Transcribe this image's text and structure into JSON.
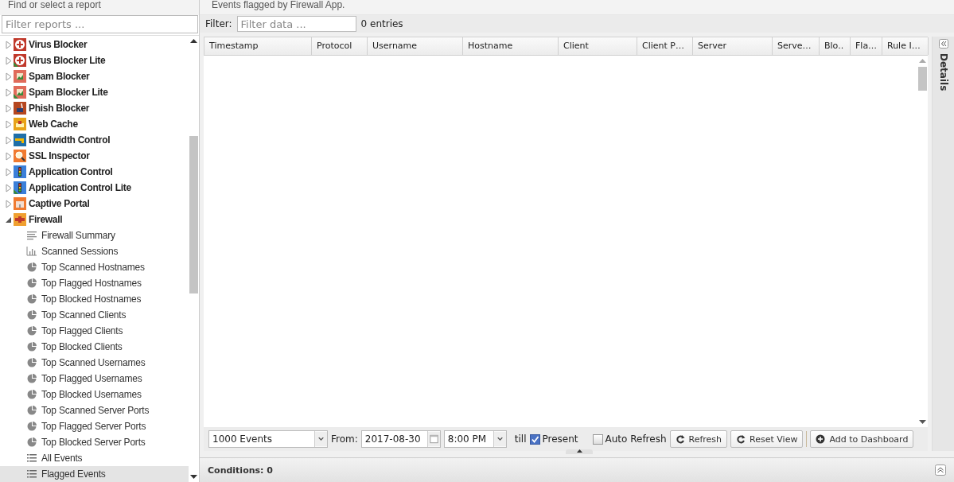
{
  "left_panel": {
    "title": "Find or select a report",
    "filter": {
      "placeholder": "Filter reports ..."
    },
    "tree": [
      {
        "label": "Virus Blocker",
        "kind": "cross",
        "color": "#c0392b",
        "lite": false,
        "expanded": false,
        "selected": false
      },
      {
        "label": "Virus Blocker Lite",
        "kind": "cross",
        "color": "#c0392b",
        "lite": true,
        "expanded": false,
        "selected": false
      },
      {
        "label": "Spam Blocker",
        "kind": "image",
        "color": "#e06b5a",
        "lite": false,
        "expanded": false,
        "selected": false
      },
      {
        "label": "Spam Blocker Lite",
        "kind": "image",
        "color": "#e06b5a",
        "lite": true,
        "expanded": false,
        "selected": false
      },
      {
        "label": "Phish Blocker",
        "kind": "hook",
        "color": "#b5461f",
        "lite": false,
        "expanded": false,
        "selected": false
      },
      {
        "label": "Web Cache",
        "kind": "tray",
        "color": "#e8a317",
        "lite": false,
        "expanded": false,
        "selected": false
      },
      {
        "label": "Bandwidth Control",
        "kind": "tap",
        "color": "#1f6fa8",
        "lite": false,
        "expanded": false,
        "selected": false
      },
      {
        "label": "SSL Inspector",
        "kind": "lens",
        "color": "#f07a30",
        "lite": false,
        "expanded": false,
        "selected": false
      },
      {
        "label": "Application Control",
        "kind": "light",
        "color": "#3b7fd9",
        "lite": false,
        "expanded": false,
        "selected": false
      },
      {
        "label": "Application Control Lite",
        "kind": "light",
        "color": "#3b7fd9",
        "lite": true,
        "expanded": false,
        "selected": false
      },
      {
        "label": "Captive Portal",
        "kind": "castle",
        "color": "#f07a30",
        "lite": false,
        "expanded": false,
        "selected": false
      },
      {
        "label": "Firewall",
        "kind": "wall",
        "color": "#f0a030",
        "lite": false,
        "expanded": true,
        "selected": false,
        "children": [
          {
            "label": "Firewall Summary",
            "kind": "text",
            "selected": false
          },
          {
            "label": "Scanned Sessions",
            "kind": "bars",
            "selected": false
          },
          {
            "label": "Top Scanned Hostnames",
            "kind": "pie",
            "selected": false
          },
          {
            "label": "Top Flagged Hostnames",
            "kind": "pie",
            "selected": false
          },
          {
            "label": "Top Blocked Hostnames",
            "kind": "pie",
            "selected": false
          },
          {
            "label": "Top Scanned Clients",
            "kind": "pie",
            "selected": false
          },
          {
            "label": "Top Flagged Clients",
            "kind": "pie",
            "selected": false
          },
          {
            "label": "Top Blocked Clients",
            "kind": "pie",
            "selected": false
          },
          {
            "label": "Top Scanned Usernames",
            "kind": "pie",
            "selected": false
          },
          {
            "label": "Top Flagged Usernames",
            "kind": "pie",
            "selected": false
          },
          {
            "label": "Top Blocked Usernames",
            "kind": "pie",
            "selected": false
          },
          {
            "label": "Top Scanned Server Ports",
            "kind": "pie",
            "selected": false
          },
          {
            "label": "Top Flagged Server Ports",
            "kind": "pie",
            "selected": false
          },
          {
            "label": "Top Blocked Server Ports",
            "kind": "pie",
            "selected": false
          },
          {
            "label": "All Events",
            "kind": "list",
            "selected": false
          },
          {
            "label": "Flagged Events",
            "kind": "list",
            "selected": true
          }
        ]
      }
    ]
  },
  "report": {
    "description": "Events flagged by Firewall App.",
    "filter_label": "Filter:",
    "filter": {
      "placeholder": "Filter data ..."
    },
    "count": "0 entries",
    "columns": [
      "Timestamp",
      "Protocol",
      "Username",
      "Hostname",
      "Client",
      "Client P…",
      "Server",
      "Serve…",
      "Blo..",
      "Fla…",
      "Rule I…"
    ],
    "limit": "1000 Events",
    "from_label": "From:",
    "date": "2017-08-30",
    "time": "8:00 PM",
    "till_label": "till",
    "present": {
      "label": "Present",
      "checked": true
    },
    "auto_refresh": {
      "label": "Auto Refresh",
      "checked": false
    },
    "buttons": [
      {
        "label": "Refresh",
        "kind": "refresh"
      },
      {
        "label": "Reset View",
        "kind": "refresh"
      },
      {
        "label": "Add to Dashboard",
        "kind": "add"
      }
    ],
    "conditions": "Conditions: 0"
  },
  "details_panel": {
    "title": "Details"
  }
}
